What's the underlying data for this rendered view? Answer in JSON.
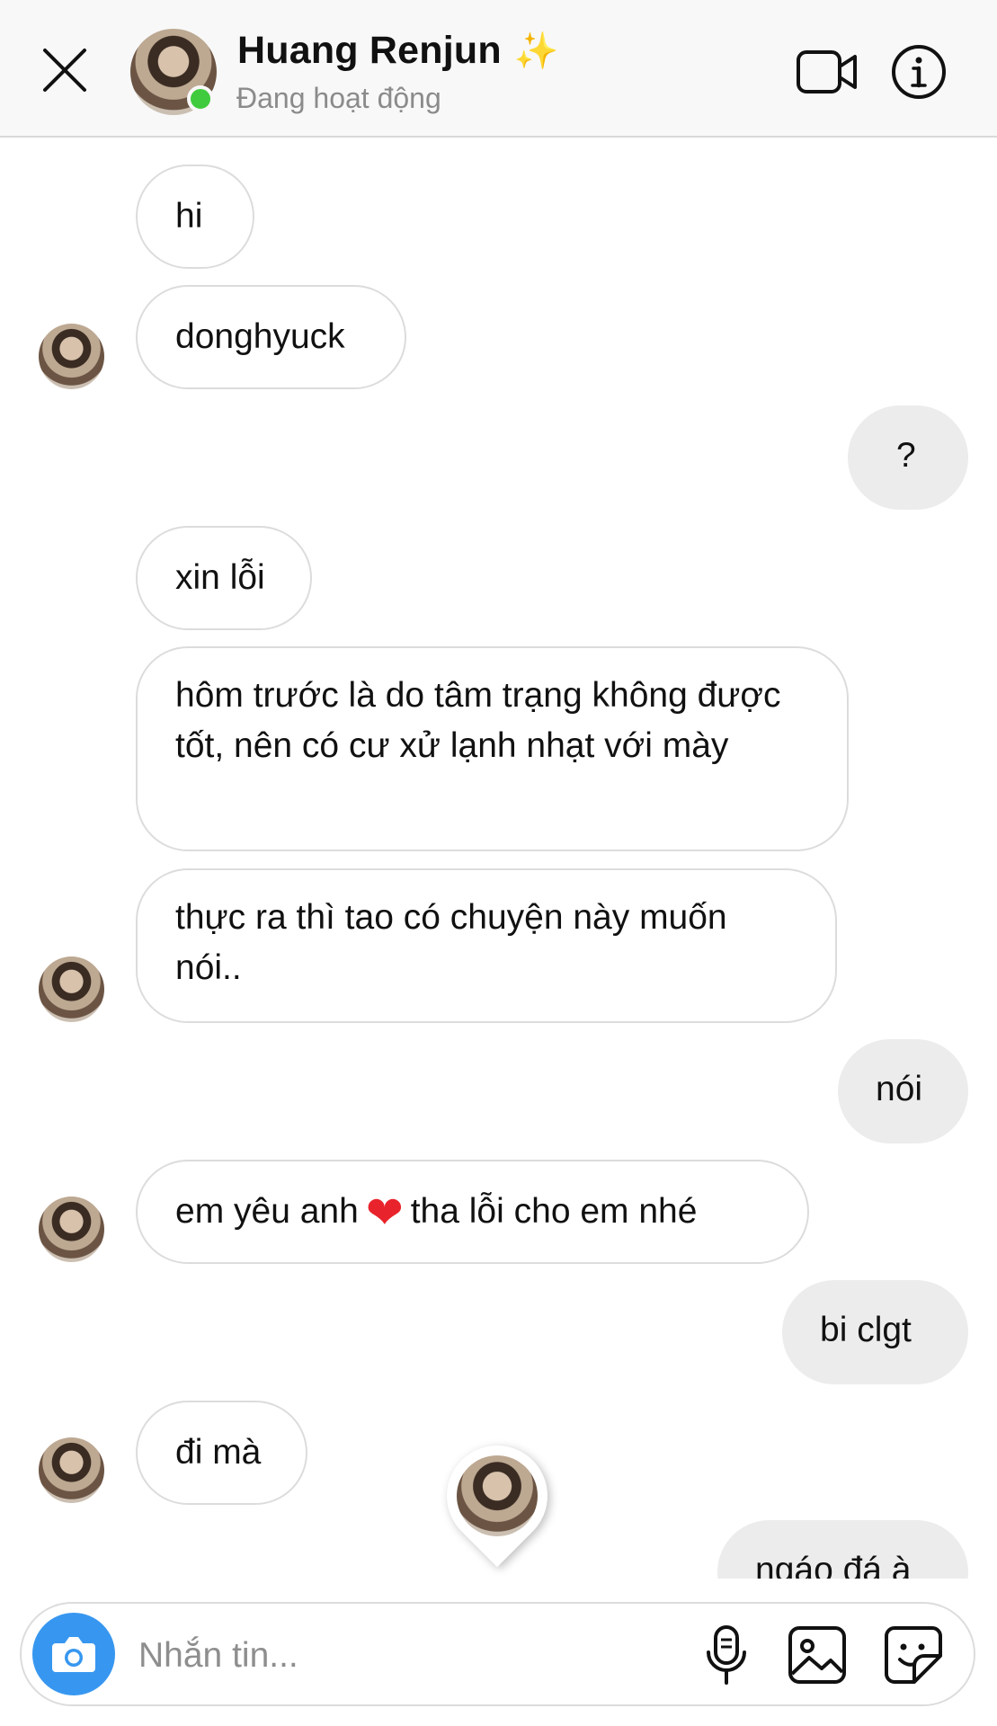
{
  "header": {
    "name": "Huang Renjun",
    "sparkle": "✨",
    "status": "Đang hoạt động"
  },
  "icons": {
    "close": "close-icon",
    "video_call": "video-camera-icon",
    "info": "info-icon",
    "camera": "camera-icon",
    "microphone": "microphone-icon",
    "gallery": "image-gallery-icon",
    "sticker": "sticker-icon"
  },
  "colors": {
    "online": "#3fcb3d",
    "camera_button": "#3797f0",
    "incoming_border": "#dcdcdc",
    "outgoing_background": "#ececec",
    "heart": "#e8232b"
  },
  "messages": [
    {
      "from": "them",
      "text": "hi"
    },
    {
      "from": "them",
      "text": "donghyuck"
    },
    {
      "from": "me",
      "text": "?"
    },
    {
      "from": "them",
      "text": "xin lỗi"
    },
    {
      "from": "them",
      "text": "hôm trước là do tâm trạng không được tốt, nên có cư xử lạnh nhạt với mày"
    },
    {
      "from": "them",
      "text": "thực ra thì tao có chuyện này muốn nói.."
    },
    {
      "from": "me",
      "text": "nói"
    },
    {
      "from": "them",
      "text_before": "em yêu anh",
      "emoji": "❤️",
      "text_after": "tha lỗi cho em nhé"
    },
    {
      "from": "me",
      "text": "bi clgt"
    },
    {
      "from": "them",
      "text": "đi mà"
    },
    {
      "from": "me",
      "text": "ngáo đá à"
    }
  ],
  "composer": {
    "placeholder": "Nhắn tin..."
  }
}
